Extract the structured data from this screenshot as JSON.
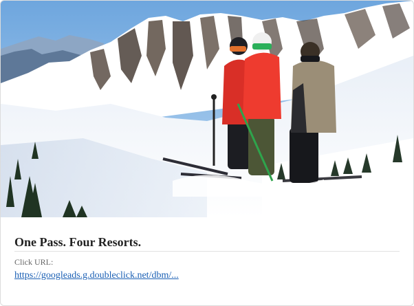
{
  "ad": {
    "image_subject": "skiers-on-mountain-ridge",
    "headline": "One Pass. Four Resorts.",
    "click_url_label": "Click URL:",
    "click_url": "https://googleads.g.doubleclick.net/dbm/..."
  },
  "colors": {
    "link": "#1a5fb4",
    "headline": "#222222",
    "label": "#666666",
    "sky": "#7fb0e0",
    "snow": "#f4f7fb",
    "jacket_red": "#e23a2e"
  }
}
